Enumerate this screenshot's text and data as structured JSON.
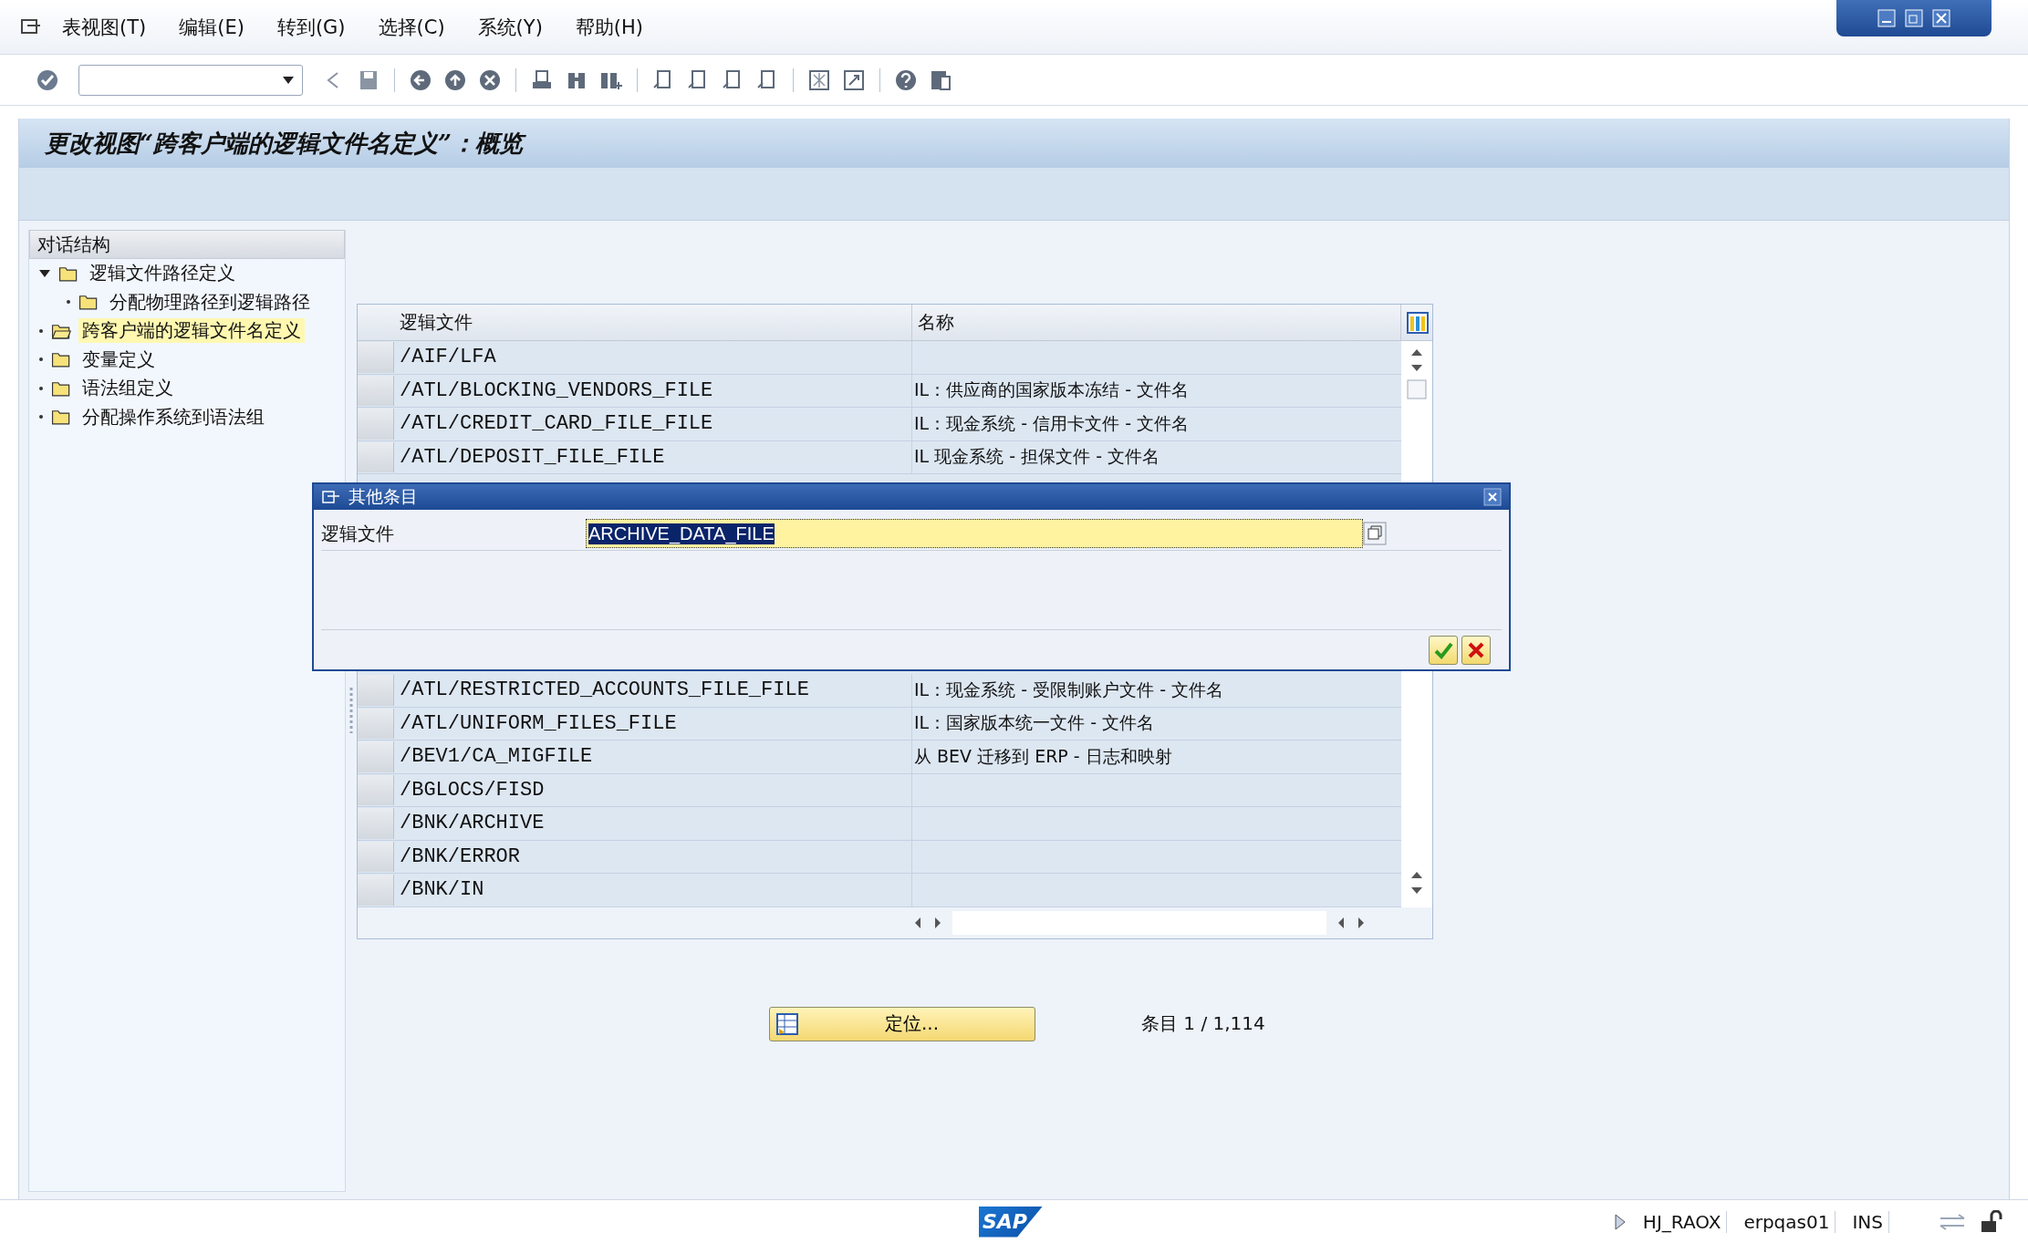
{
  "menu": [
    {
      "label": "表视图(T)"
    },
    {
      "label": "编辑(E)"
    },
    {
      "label": "转到(G)"
    },
    {
      "label": "选择(C)"
    },
    {
      "label": "系统(Y)"
    },
    {
      "label": "帮助(H)"
    }
  ],
  "screen_title": "更改视图“跨客户端的逻辑文件名定义”：概览",
  "tree": {
    "title": "对话结构",
    "items": [
      {
        "label": "逻辑文件路径定义",
        "selected": false,
        "children": [
          {
            "label": "分配物理路径到逻辑路径",
            "selected": false
          }
        ]
      },
      {
        "label": "跨客户端的逻辑文件名定义",
        "selected": true
      },
      {
        "label": "变量定义",
        "selected": false
      },
      {
        "label": "语法组定义",
        "selected": false
      },
      {
        "label": "分配操作系统到语法组",
        "selected": false
      }
    ]
  },
  "table": {
    "columns": [
      "逻辑文件",
      "名称"
    ],
    "rows_top": [
      {
        "file": "/AIF/LFA"
      },
      {
        "file": "/ATL/BLOCKING_VENDORS_FILE",
        "name": "IL：供应商的国家版本冻结 - 文件名"
      },
      {
        "file": "/ATL/CREDIT_CARD_FILE_FILE",
        "name": "IL：现金系统 - 信用卡文件 - 文件名"
      },
      {
        "file": "/ATL/DEPOSIT_FILE_FILE",
        "name": "IL 现金系统 - 担保文件 - 文件名"
      }
    ],
    "rows_bottom": [
      {
        "file": "/ATL/RESTRICTED_ACCOUNTS_FILE_FILE",
        "name": "IL：现金系统 - 受限制账户文件 - 文件名"
      },
      {
        "file": "/ATL/UNIFORM_FILES_FILE",
        "name": "IL：国家版本统一文件 - 文件名"
      },
      {
        "file": "/BEV1/CA_MIGFILE",
        "name": "从 BEV 迁移到 ERP - 日志和映射"
      },
      {
        "file": "/BGLOCS/FISD"
      },
      {
        "file": "/BNK/ARCHIVE"
      },
      {
        "file": "/BNK/ERROR"
      },
      {
        "file": "/BNK/IN"
      }
    ]
  },
  "position_button": "定位...",
  "entry_count": "条目 1 / 1,114",
  "dialog": {
    "title": "其他条目",
    "field_label": "逻辑文件",
    "field_value": "ARCHIVE_DATA_FILE"
  },
  "status_bar": {
    "logo": "SAP",
    "user": "HJ_RAOX",
    "server": "erpqas01",
    "mode": "INS"
  }
}
